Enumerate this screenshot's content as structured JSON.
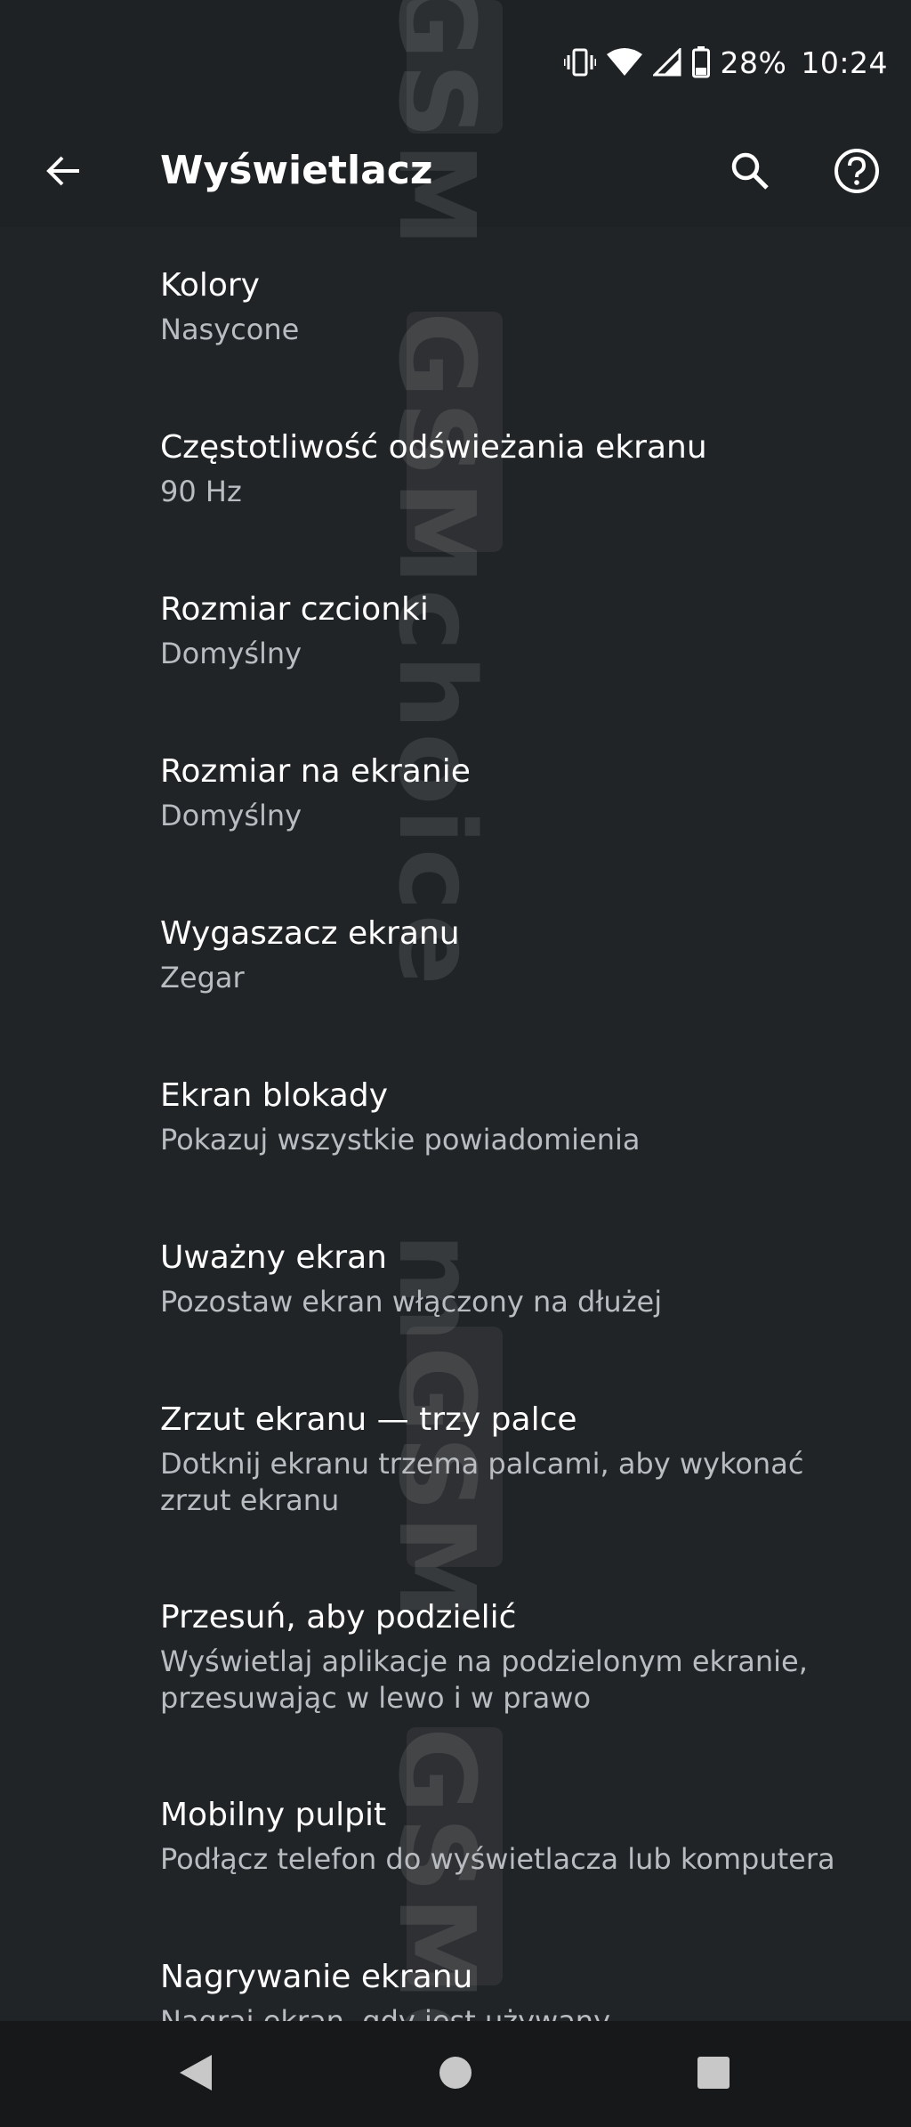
{
  "status_bar": {
    "battery_text": "28%",
    "time": "10:24",
    "icons": [
      "vibrate-icon",
      "wifi-icon",
      "cellular-signal-icon",
      "battery-icon"
    ]
  },
  "app_bar": {
    "title": "Wyświetlacz",
    "back_icon": "arrow-back-icon",
    "search_icon": "search-icon",
    "help_icon": "help-icon"
  },
  "settings": {
    "items": [
      {
        "title": "Kolory",
        "summary": "Nasycone"
      },
      {
        "title": "Częstotliwość odświeżania ekranu",
        "summary": "90 Hz"
      },
      {
        "title": "Rozmiar czcionki",
        "summary": "Domyślny"
      },
      {
        "title": "Rozmiar na ekranie",
        "summary": "Domyślny"
      },
      {
        "title": "Wygaszacz ekranu",
        "summary": "Zegar"
      },
      {
        "title": "Ekran blokady",
        "summary": "Pokazuj wszystkie powiadomienia"
      },
      {
        "title": "Uważny ekran",
        "summary": "Pozostaw ekran włączony na dłużej"
      },
      {
        "title": "Zrzut ekranu — trzy palce",
        "summary": "Dotknij ekranu trzema palcami, aby wykonać zrzut ekranu"
      },
      {
        "title": "Przesuń, aby podzielić",
        "summary": "Wyświetlaj aplikacje na podzielonym ekranie, przesuwając w lewo i w prawo"
      },
      {
        "title": "Mobilny pulpit",
        "summary": "Podłącz telefon do wyświetlacza lub komputera"
      },
      {
        "title": "Nagrywanie ekranu",
        "summary": "Nagraj ekran, gdy jest używany"
      }
    ]
  },
  "watermark": {
    "text_top": "GSM",
    "text_mid": "GSMchoice",
    "text_lower": "mGSM",
    "text_bottom": "GSMc"
  },
  "nav_bar": {
    "icons": [
      "nav-back-icon",
      "nav-home-icon",
      "nav-recents-icon"
    ]
  },
  "colors": {
    "background": "#212427",
    "bar_background": "#1f2225",
    "nav_background": "#171819",
    "title_text": "#ffffff",
    "summary_text": "#b9bcc0"
  }
}
